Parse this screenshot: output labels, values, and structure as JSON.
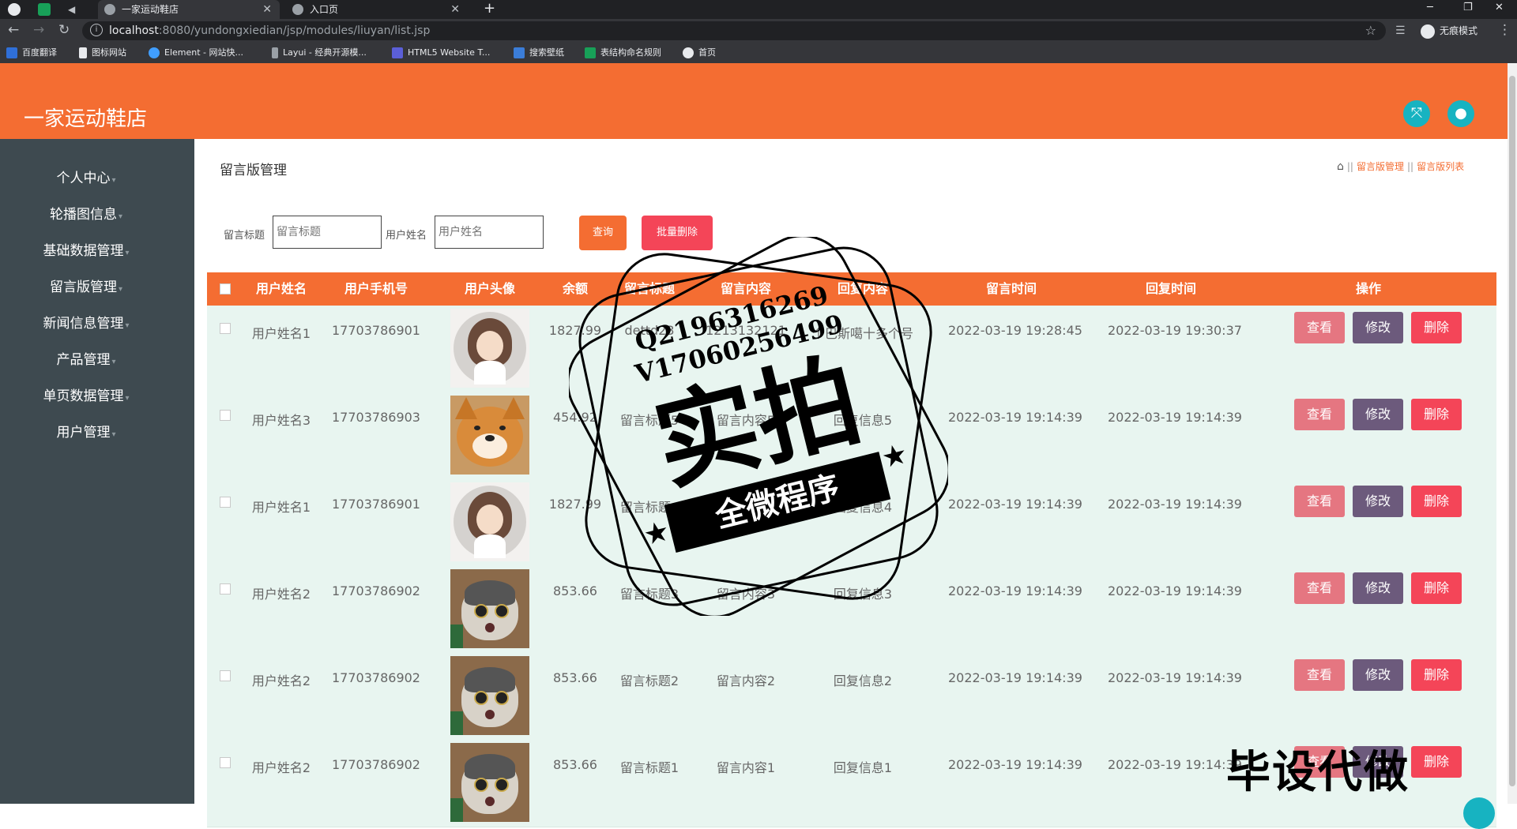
{
  "browser": {
    "tabs": [
      {
        "title": "一家运动鞋店",
        "active": true
      },
      {
        "title": "入口页",
        "active": false
      }
    ],
    "url_host": "localhost",
    "url_path": ":8080/yundongxiedian/jsp/modules/liuyan/list.jsp",
    "incognito_label": "无痕模式",
    "bookmarks": [
      "百度翻译",
      "图标网站",
      "Element - 网站快...",
      "Layui - 经典开源模...",
      "HTML5 Website T...",
      "搜索壁纸",
      "表结构命名规则",
      "首页"
    ]
  },
  "app": {
    "title": "一家运动鞋店",
    "sidebar": [
      "个人中心",
      "轮播图信息",
      "基础数据管理",
      "留言版管理",
      "新闻信息管理",
      "产品管理",
      "单页数据管理",
      "用户管理"
    ]
  },
  "page": {
    "title": "留言版管理",
    "breadcrumb": [
      "留言版管理",
      "留言版列表"
    ],
    "filters": [
      {
        "label": "留言标题",
        "placeholder": "留言标题"
      },
      {
        "label": "用户姓名",
        "placeholder": "用户姓名"
      }
    ],
    "query_button": "查询",
    "batch_delete_button": "批量删除"
  },
  "table": {
    "headers": [
      "用户姓名",
      "用户手机号",
      "用户头像",
      "余额",
      "留言标题",
      "留言内容",
      "回复内容",
      "留言时间",
      "回复时间",
      "操作"
    ],
    "actions": {
      "view": "查看",
      "edit": "修改",
      "delete": "删除"
    },
    "rows": [
      {
        "name": "用户姓名1",
        "phone": "17703786901",
        "avatar": "girl-avatar",
        "balance": "1827.99",
        "title": "dettd23",
        "content": "1213132121",
        "reply": "个巴斯噶十多个号",
        "msg_time": "2022-03-19 19:28:45",
        "reply_time": "2022-03-19 19:30:37"
      },
      {
        "name": "用户姓名3",
        "phone": "17703786903",
        "avatar": "shiba-dog-avatar",
        "balance": "454.92",
        "title": "留言标题5",
        "content": "留言内容5",
        "reply": "回复信息5",
        "msg_time": "2022-03-19 19:14:39",
        "reply_time": "2022-03-19 19:14:39"
      },
      {
        "name": "用户姓名1",
        "phone": "17703786901",
        "avatar": "girl-avatar",
        "balance": "1827.99",
        "title": "留言标题4",
        "content": "留言内容4",
        "reply": "回复信息4",
        "msg_time": "2022-03-19 19:14:39",
        "reply_time": "2022-03-19 19:14:39"
      },
      {
        "name": "用户姓名2",
        "phone": "17703786902",
        "avatar": "cat-avatar",
        "balance": "853.66",
        "title": "留言标题3",
        "content": "留言内容3",
        "reply": "回复信息3",
        "msg_time": "2022-03-19 19:14:39",
        "reply_time": "2022-03-19 19:14:39"
      },
      {
        "name": "用户姓名2",
        "phone": "17703786902",
        "avatar": "cat-avatar",
        "balance": "853.66",
        "title": "留言标题2",
        "content": "留言内容2",
        "reply": "回复信息2",
        "msg_time": "2022-03-19 19:14:39",
        "reply_time": "2022-03-19 19:14:39"
      },
      {
        "name": "用户姓名2",
        "phone": "17703786902",
        "avatar": "cat-avatar",
        "balance": "853.66",
        "title": "留言标题1",
        "content": "留言内容1",
        "reply": "回复信息1",
        "msg_time": "2022-03-19 19:14:39",
        "reply_time": "2022-03-19 19:14:39"
      }
    ]
  },
  "watermark": {
    "line1": "Q2196316269",
    "line2": "V17060256499",
    "big": "实拍",
    "banner": "全微程序",
    "bottom": "毕设代做"
  },
  "colors": {
    "brand": "#f46d32",
    "sidebar": "#3e4a50",
    "row_bg": "#e8f5f0",
    "view": "#e57681",
    "edit": "#6c5a7c",
    "delete": "#f44558",
    "teal": "#17b3c1"
  }
}
